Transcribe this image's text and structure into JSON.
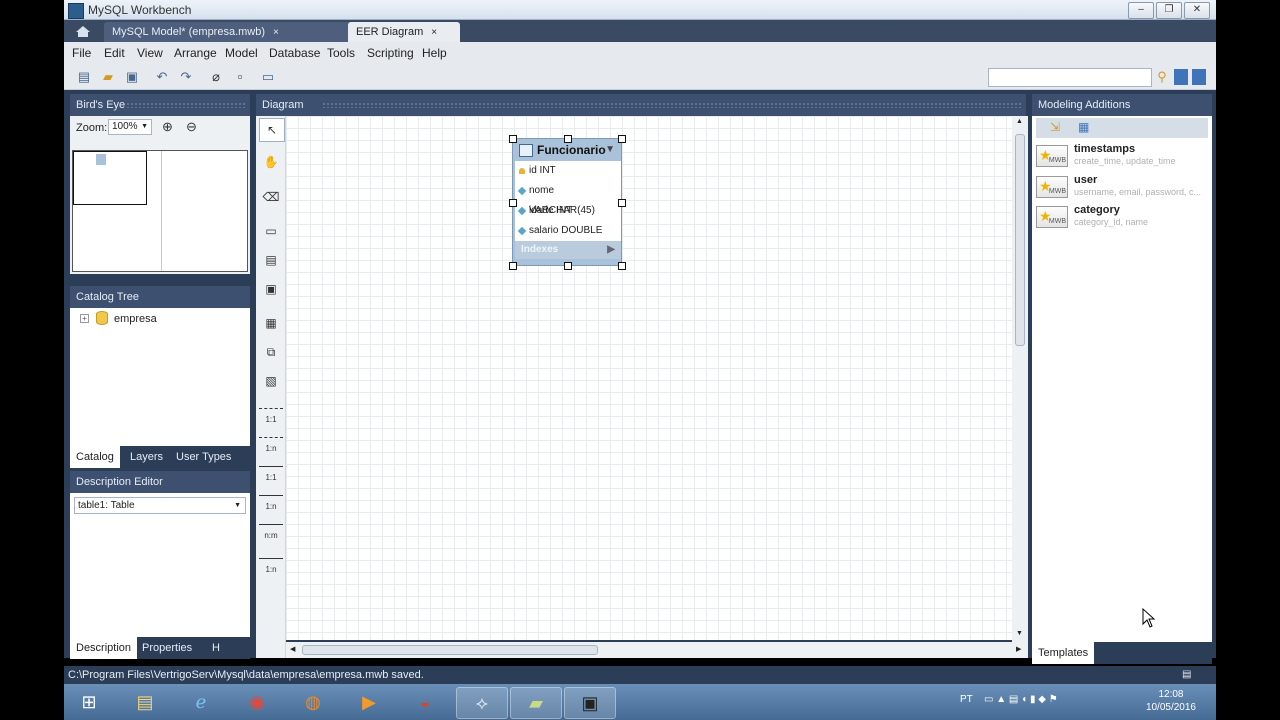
{
  "window": {
    "title": "MySQL Workbench",
    "min": "‒",
    "max": "❐",
    "close": "✕"
  },
  "tabs": [
    {
      "label": "MySQL Model* (empresa.mwb)",
      "close": "×"
    },
    {
      "label": "EER Diagram",
      "close": "×"
    }
  ],
  "menu": [
    "File",
    "Edit",
    "View",
    "Arrange",
    "Model",
    "Database",
    "Tools",
    "Scripting",
    "Help"
  ],
  "birds_eye": {
    "title": "Bird's Eye",
    "zoom_label": "Zoom:",
    "zoom_value": "100%"
  },
  "catalog": {
    "title": "Catalog Tree",
    "schema": "empresa",
    "tabs": [
      "Catalog",
      "Layers",
      "User Types"
    ]
  },
  "description": {
    "title": "Description Editor",
    "selected": "table1: Table",
    "tabs": [
      "Description",
      "Properties",
      "H"
    ]
  },
  "diagram": {
    "title": "Diagram",
    "entity": {
      "name": "Funcionario",
      "columns": [
        {
          "label": "id INT",
          "key": true
        },
        {
          "label": "nome VARCHAR(45)",
          "key": false
        },
        {
          "label": "idade INT",
          "key": false
        },
        {
          "label": "salario DOUBLE",
          "key": false
        }
      ],
      "indexes_label": "Indexes"
    },
    "tools": [
      "↖",
      "✋",
      "⌫",
      "▭",
      "▤",
      "▣",
      "▦",
      "⧉",
      "▧",
      "1:1",
      "1:n",
      "1:1",
      "1:n",
      "n:m",
      "1:n"
    ]
  },
  "modeling": {
    "title": "Modeling Additions",
    "templates": [
      {
        "name": "timestamps",
        "desc": "create_time, update_time"
      },
      {
        "name": "user",
        "desc": "username, email, password, c..."
      },
      {
        "name": "category",
        "desc": "category_id, name"
      }
    ],
    "tab": "Templates",
    "badge": "MWB"
  },
  "status": {
    "text": "C:\\Program Files\\VertrigoServ\\Mysql\\data\\empresa\\empresa.mwb saved."
  },
  "taskbar": {
    "lang": "PT",
    "time": "12:08",
    "date": "10/05/2016"
  }
}
